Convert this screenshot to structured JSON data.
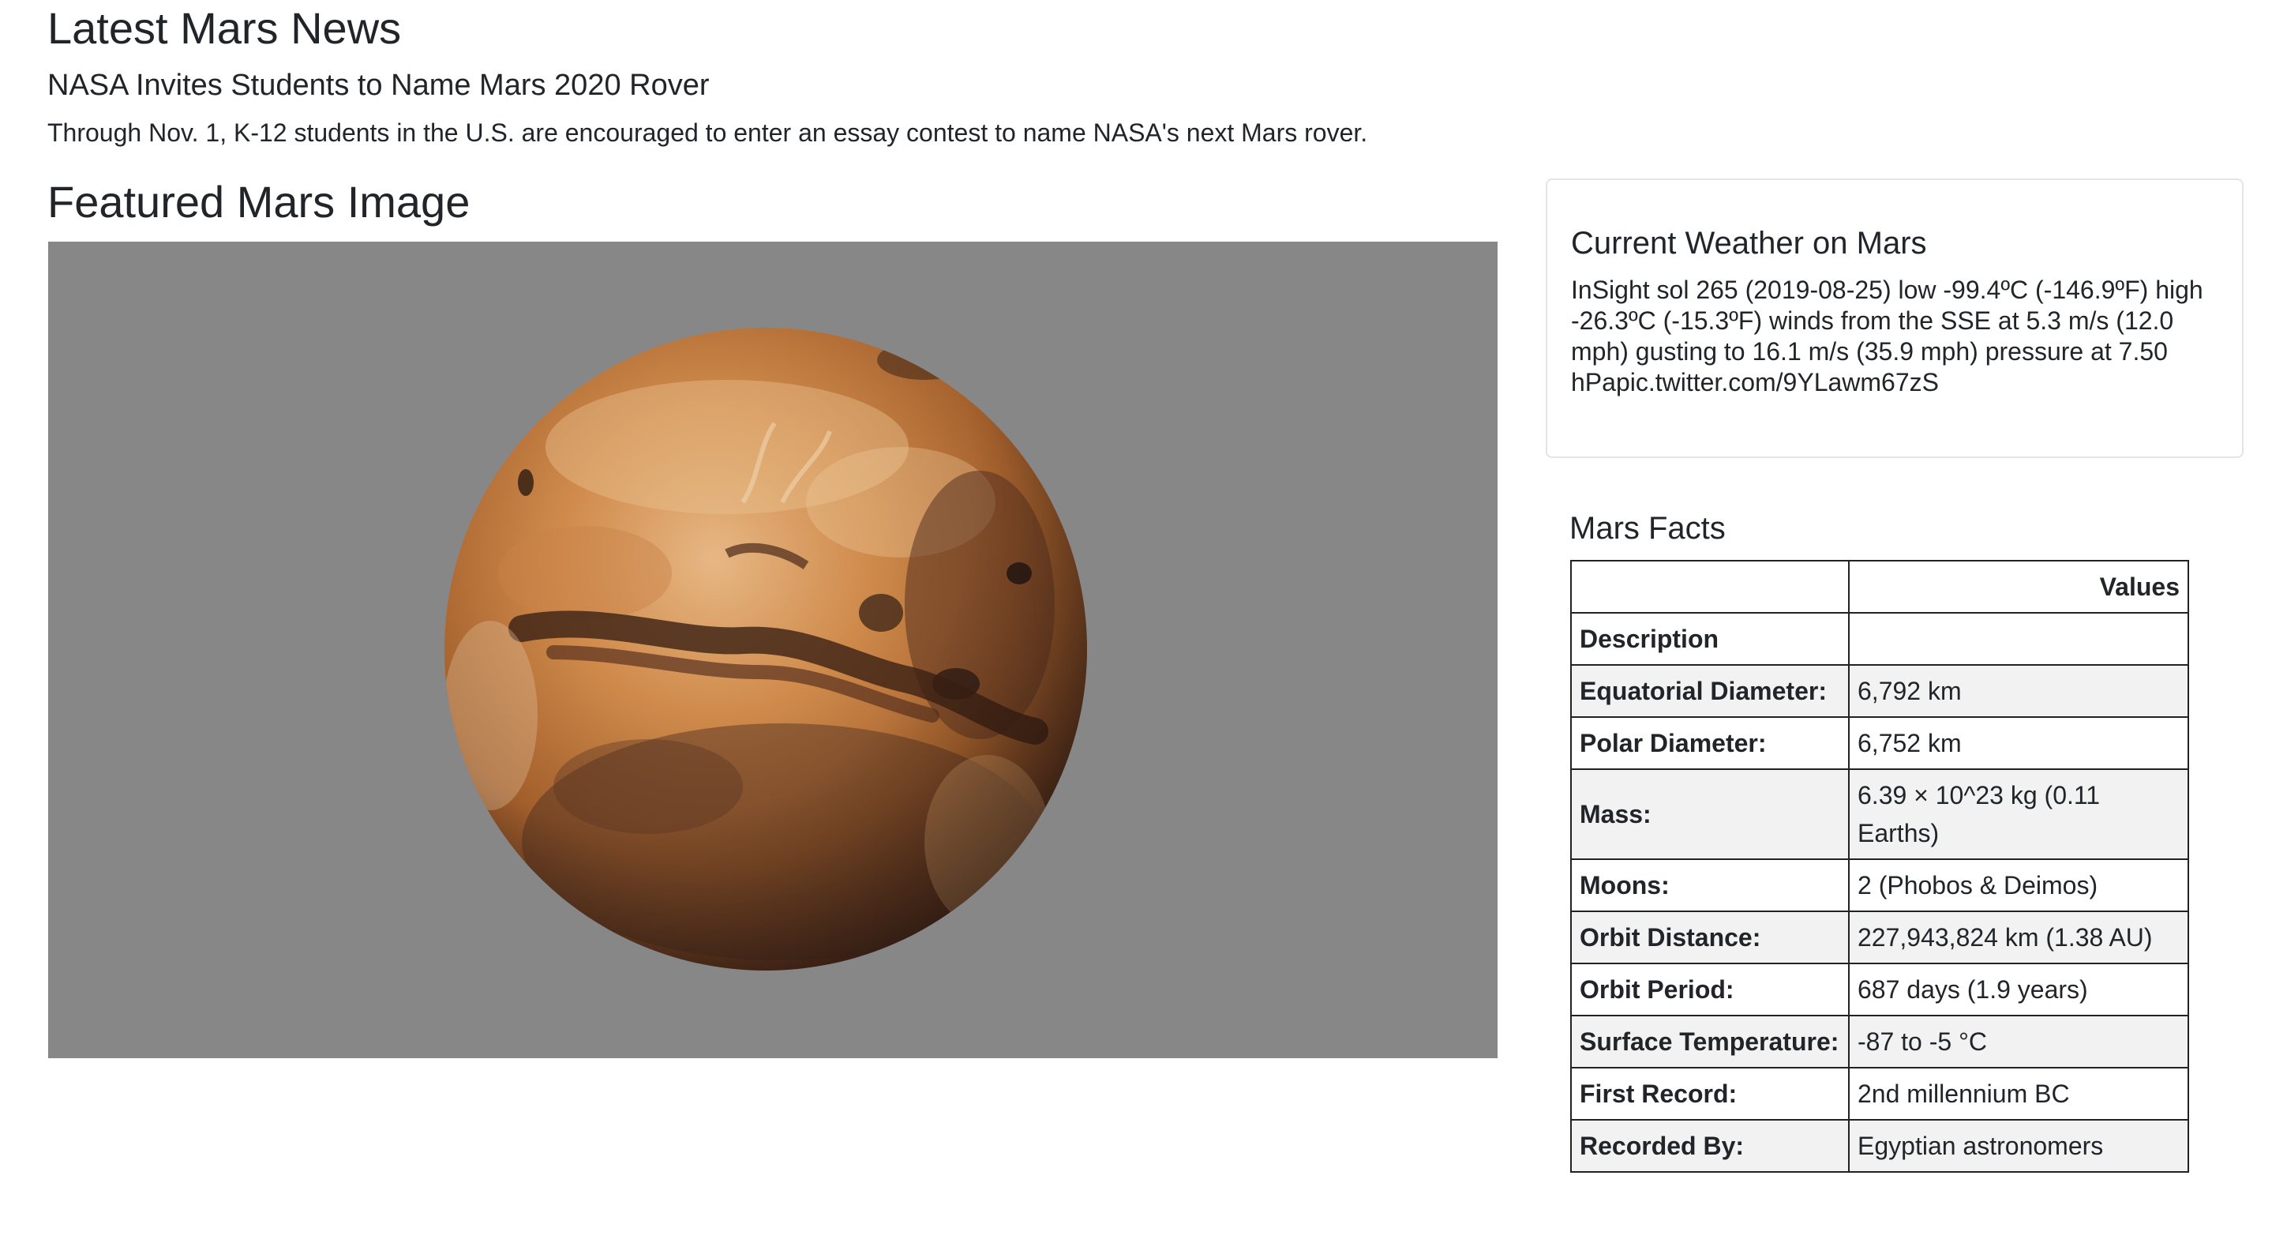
{
  "news": {
    "heading": "Latest Mars News",
    "title": "NASA Invites Students to Name Mars 2020 Rover",
    "teaser": "Through Nov. 1, K-12 students in the U.S. are encouraged to enter an essay contest to name NASA's next Mars rover."
  },
  "featured": {
    "heading": "Featured Mars Image",
    "background_color": "#878787"
  },
  "weather": {
    "title": "Current Weather on Mars",
    "text": "InSight sol 265 (2019-08-25) low -99.4ºC (-146.9ºF) high -26.3ºC (-15.3ºF) winds from the SSE at 5.3 m/s (12.0 mph) gusting to 16.1 m/s (35.9 mph) pressure at 7.50 hPapic.twitter.com/9YLawm67zS"
  },
  "facts": {
    "heading": "Mars Facts",
    "header_blank": "",
    "header_values": "Values",
    "description_label": "Description",
    "rows": [
      {
        "label": "Equatorial Diameter:",
        "value": "6,792 km"
      },
      {
        "label": "Polar Diameter:",
        "value": "6,752 km"
      },
      {
        "label": "Mass:",
        "value": "6.39 × 10^23 kg (0.11 Earths)"
      },
      {
        "label": "Moons:",
        "value": "2 (Phobos & Deimos)"
      },
      {
        "label": "Orbit Distance:",
        "value": "227,943,824 km (1.38 AU)"
      },
      {
        "label": "Orbit Period:",
        "value": "687 days (1.9 years)"
      },
      {
        "label": "Surface Temperature:",
        "value": "-87 to -5 °C"
      },
      {
        "label": "First Record:",
        "value": "2nd millennium BC"
      },
      {
        "label": "Recorded By:",
        "value": "Egyptian astronomers"
      }
    ]
  }
}
